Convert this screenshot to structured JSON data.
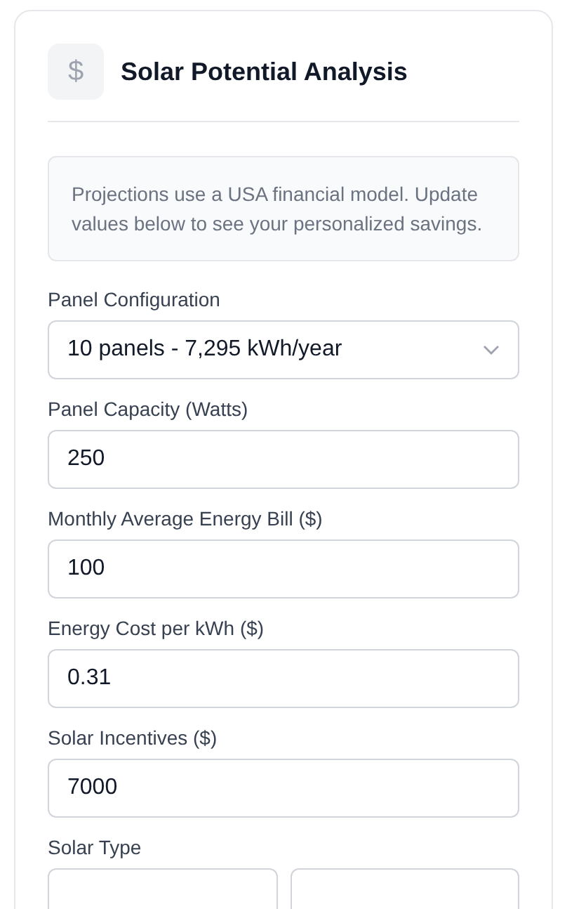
{
  "header": {
    "icon": "$",
    "title": "Solar Potential Analysis"
  },
  "notice": "Projections use a USA financial model. Update values below to see your personalized savings.",
  "fields": [
    {
      "kind": "select",
      "label": "Panel Configuration",
      "value": "10 panels - 7,295 kWh/year"
    },
    {
      "kind": "input",
      "label": "Panel Capacity (Watts)",
      "value": "250"
    },
    {
      "kind": "input",
      "label": "Monthly Average Energy Bill ($)",
      "value": "100"
    },
    {
      "kind": "input",
      "label": "Energy Cost per kWh ($)",
      "value": "0.31"
    },
    {
      "kind": "input",
      "label": "Solar Incentives ($)",
      "value": "7000"
    }
  ],
  "solar_type": {
    "label": "Solar Type",
    "options": [
      {
        "kind": "option"
      },
      {
        "kind": "option"
      }
    ]
  }
}
